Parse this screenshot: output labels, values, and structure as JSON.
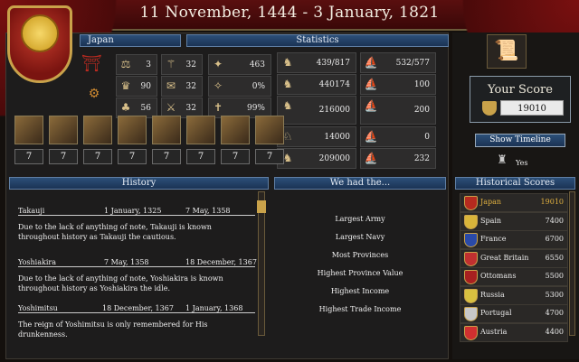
{
  "header": {
    "date_range": "11 November, 1444 - 3 January, 1821"
  },
  "country": {
    "name": "Japan"
  },
  "stats_header": "Statistics",
  "left_stats": [
    [
      "3",
      "32",
      "463"
    ],
    [
      "90",
      "32",
      "0%"
    ],
    [
      "56",
      "32",
      "99%"
    ]
  ],
  "mid_stats": [
    "439/817",
    "440174",
    "216000",
    "14000",
    "209000"
  ],
  "right_stats": [
    "532/577",
    "100",
    "200",
    "0",
    "232"
  ],
  "ideas": [
    "7",
    "7",
    "7",
    "7",
    "7",
    "7",
    "7",
    "7"
  ],
  "your_score": {
    "label": "Your Score",
    "value": "19010"
  },
  "timeline_button": "Show Timeline",
  "yes_label": "Yes",
  "history": {
    "header": "History",
    "entries": [
      {
        "name": "Takauji",
        "start": "1 January, 1325",
        "end": "7 May, 1358",
        "text": "Due to the lack of anything of note, Takauji is known throughout history as Takauji the cautious."
      },
      {
        "name": "Yoshiakira",
        "start": "7 May, 1358",
        "end": "18 December, 1367",
        "text": "Due to the lack of anything of note, Yoshiakira is known throughout history as Yoshiakira the idle."
      },
      {
        "name": "Yoshimitsu",
        "start": "18 December, 1367",
        "end": "1 January, 1368",
        "text": "The reign of Yoshimitsu is only remembered for His drunkenness."
      }
    ]
  },
  "achievements": {
    "header": "We had the...",
    "items": [
      "Largest Army",
      "Largest Navy",
      "Most Provinces",
      "Highest Province Value",
      "Highest Income",
      "Highest Trade Income"
    ]
  },
  "historical": {
    "header": "Historical Scores",
    "rows": [
      {
        "name": "Japan",
        "score": "19010",
        "color": "#e0b040",
        "flag": "#b52a1f"
      },
      {
        "name": "Spain",
        "score": "7400",
        "color": "#eaeaea",
        "flag": "#d8b43a"
      },
      {
        "name": "France",
        "score": "6700",
        "color": "#eaeaea",
        "flag": "#2a4aa8"
      },
      {
        "name": "Great Britain",
        "score": "6550",
        "color": "#eaeaea",
        "flag": "#c03030"
      },
      {
        "name": "Ottomans",
        "score": "5500",
        "color": "#eaeaea",
        "flag": "#a82020"
      },
      {
        "name": "Russia",
        "score": "5300",
        "color": "#eaeaea",
        "flag": "#d8c040"
      },
      {
        "name": "Portugal",
        "score": "4700",
        "color": "#eaeaea",
        "flag": "#c8c8c8"
      },
      {
        "name": "Austria",
        "score": "4400",
        "color": "#eaeaea",
        "flag": "#d03030"
      }
    ]
  }
}
